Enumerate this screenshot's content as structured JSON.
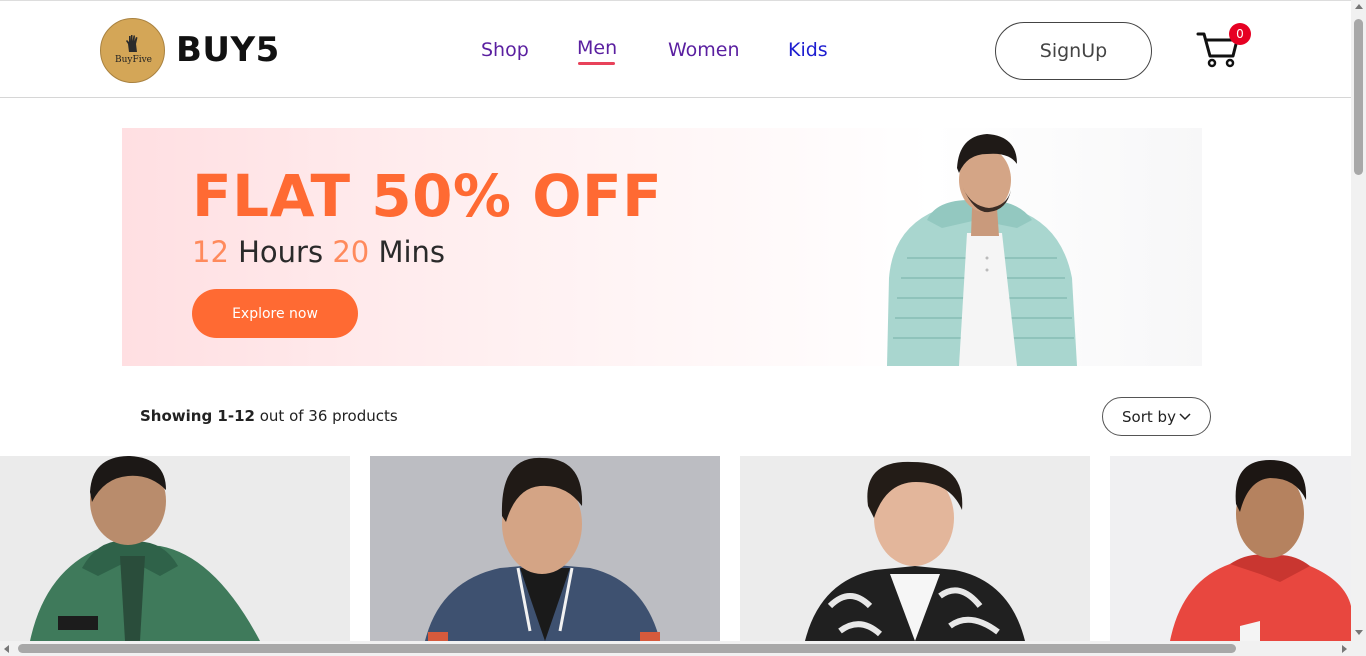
{
  "header": {
    "logo_text": "BuyFive",
    "brand": "BUY5",
    "nav": [
      {
        "label": "Shop"
      },
      {
        "label": "Men"
      },
      {
        "label": "Women"
      },
      {
        "label": "Kids"
      }
    ],
    "active_nav": "Men",
    "signup_label": "SignUp",
    "cart_count": "0",
    "icons": {
      "logo": "hand-icon",
      "cart": "cart-icon"
    },
    "colors": {
      "nav_purple": "#5a1fa0",
      "nav_blue": "#1e1ed0",
      "underline": "#e8425a",
      "badge": "#e60023"
    }
  },
  "banner": {
    "headline": "FLAT 50% OFF",
    "hours_value": "12",
    "hours_label": "Hours",
    "mins_value": "20",
    "mins_label": "Mins",
    "cta_label": "Explore now",
    "colors": {
      "accent": "#ff6a33",
      "accent_light": "#ff8a5c"
    }
  },
  "listing": {
    "showing_range": "Showing 1-12",
    "showing_rest": "out of 36 products",
    "sort_label": "Sort by",
    "sort_icon": "chevron-down-icon"
  },
  "products": [
    {
      "description": "green hoodie"
    },
    {
      "description": "navy bomber jacket"
    },
    {
      "description": "black and white printed bomber"
    },
    {
      "description": "red jacket"
    }
  ]
}
